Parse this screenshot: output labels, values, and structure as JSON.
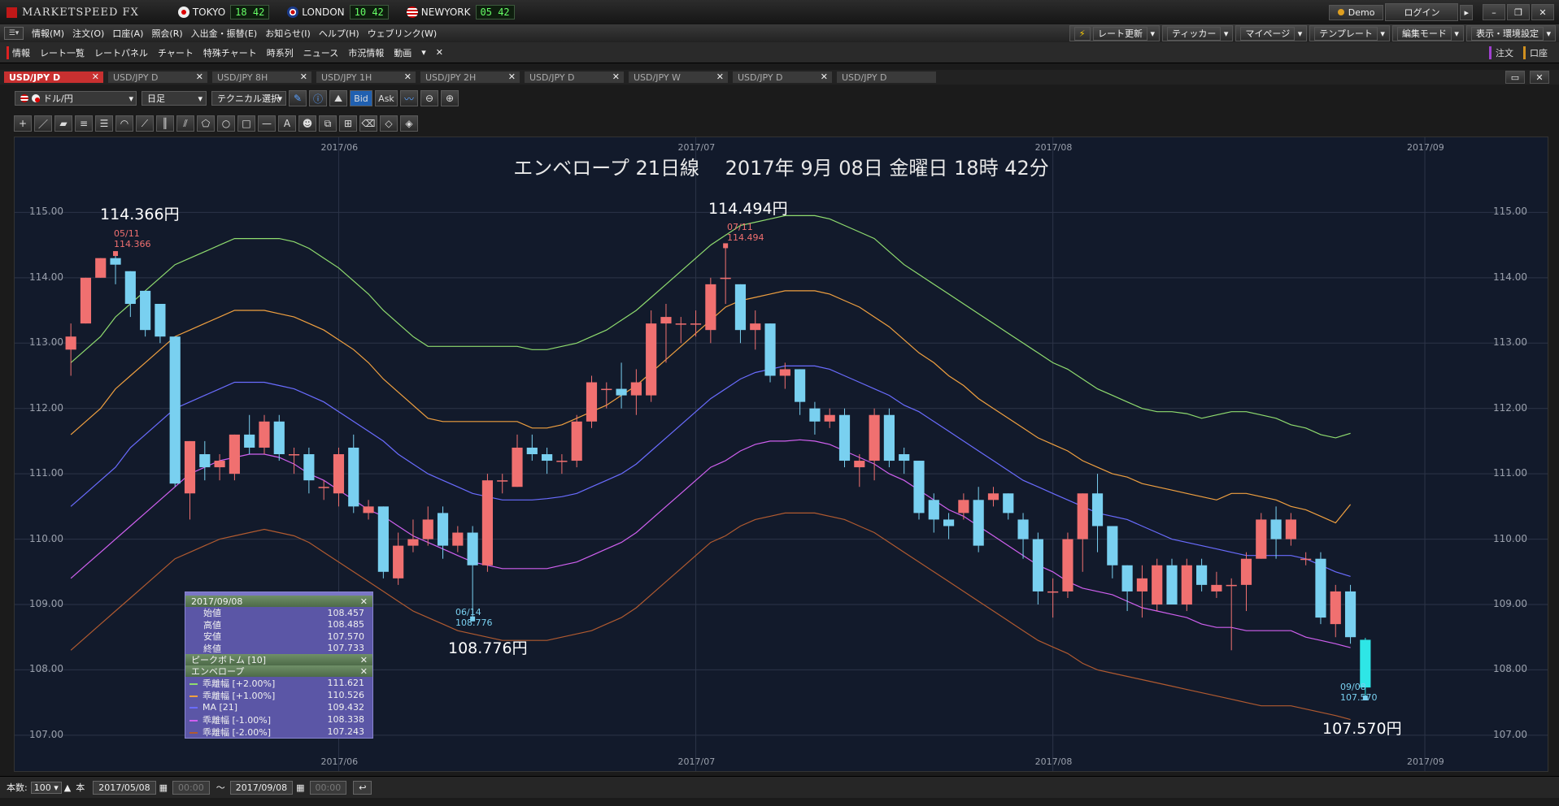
{
  "app": {
    "name": "MARKETSPEED FX"
  },
  "clocks": [
    {
      "city": "TOKYO",
      "time": "18 42"
    },
    {
      "city": "LONDON",
      "time": "10 42"
    },
    {
      "city": "NEWYORK",
      "time": "05 42"
    }
  ],
  "titlebar": {
    "demo_label": "Demo",
    "login_label": "ログイン"
  },
  "menu": [
    "情報(M)",
    "注文(O)",
    "口座(A)",
    "照会(R)",
    "入出金・振替(E)",
    "お知らせ(I)",
    "ヘルプ(H)",
    "ウェブリンク(W)"
  ],
  "right_menu": [
    "レート更新",
    "ティッカー",
    "マイページ",
    "テンプレート",
    "編集モード",
    "表示・環境設定"
  ],
  "shortcuts": [
    "情報",
    "レート一覧",
    "レートパネル",
    "チャート",
    "特殊チャート",
    "時系列",
    "ニュース",
    "市況情報",
    "動画"
  ],
  "shortcut_right": [
    "注文",
    "口座"
  ],
  "tabs": [
    {
      "label": "USD/JPY D",
      "active": true
    },
    {
      "label": "USD/JPY D",
      "active": false
    },
    {
      "label": "USD/JPY 8H",
      "active": false
    },
    {
      "label": "USD/JPY 1H",
      "active": false
    },
    {
      "label": "USD/JPY 2H",
      "active": false
    },
    {
      "label": "USD/JPY D",
      "active": false
    },
    {
      "label": "USD/JPY W",
      "active": false
    },
    {
      "label": "USD/JPY D",
      "active": false
    },
    {
      "label": "USD/JPY D",
      "active": false
    }
  ],
  "chart_options": {
    "pair": "ドル/円",
    "period": "日足",
    "technical": "テクニカル選択",
    "bid": "Bid",
    "ask": "Ask"
  },
  "chart_data": {
    "type": "candlestick",
    "title": "エンベロープ 21日線　 2017年 9月 08日 金曜日 18時 42分",
    "ylim": [
      106.7,
      115.9
    ],
    "y_ticks": [
      "115.00",
      "114.00",
      "113.00",
      "112.00",
      "111.00",
      "110.00",
      "109.00",
      "108.00",
      "107.00"
    ],
    "y_tick_values": [
      115,
      114,
      113,
      112,
      111,
      110,
      109,
      108,
      107
    ],
    "x_ticks": [
      "2017/06",
      "2017/07",
      "2017/08",
      "2017/09"
    ],
    "x_tick_index": [
      18,
      42,
      66,
      91
    ],
    "candles": [
      [
        112.9,
        113.1,
        112.5,
        113.3
      ],
      [
        113.3,
        114.0,
        113.3,
        114.0
      ],
      [
        114.0,
        114.3,
        114.0,
        114.3
      ],
      [
        114.3,
        114.2,
        113.9,
        114.37
      ],
      [
        114.1,
        113.6,
        113.4,
        114.1
      ],
      [
        113.8,
        113.2,
        113.1,
        113.8
      ],
      [
        113.6,
        113.1,
        113.0,
        113.6
      ],
      [
        113.1,
        110.85,
        110.8,
        113.1
      ],
      [
        110.7,
        111.5,
        110.3,
        111.5
      ],
      [
        111.3,
        111.1,
        110.9,
        111.5
      ],
      [
        111.1,
        111.2,
        110.9,
        111.3
      ],
      [
        111.0,
        111.6,
        110.9,
        111.6
      ],
      [
        111.6,
        111.4,
        111.3,
        111.9
      ],
      [
        111.4,
        111.8,
        111.3,
        111.9
      ],
      [
        111.8,
        111.3,
        111.2,
        111.9
      ],
      [
        111.3,
        111.3,
        111.0,
        111.4
      ],
      [
        111.3,
        110.9,
        110.7,
        111.4
      ],
      [
        110.8,
        110.8,
        110.6,
        110.9
      ],
      [
        110.7,
        111.3,
        110.5,
        111.4
      ],
      [
        111.4,
        110.5,
        110.4,
        111.6
      ],
      [
        110.4,
        110.5,
        110.3,
        110.6
      ],
      [
        110.5,
        109.5,
        109.4,
        110.5
      ],
      [
        109.4,
        109.9,
        109.3,
        110.1
      ],
      [
        109.9,
        110.0,
        109.8,
        110.3
      ],
      [
        110.0,
        110.3,
        109.9,
        110.5
      ],
      [
        110.4,
        109.9,
        109.7,
        110.5
      ],
      [
        109.9,
        110.1,
        109.8,
        110.2
      ],
      [
        110.1,
        109.6,
        108.78,
        110.2
      ],
      [
        109.6,
        110.9,
        109.5,
        111.0
      ],
      [
        110.9,
        110.9,
        110.7,
        111.0
      ],
      [
        110.8,
        111.4,
        110.8,
        111.6
      ],
      [
        111.4,
        111.3,
        111.2,
        111.6
      ],
      [
        111.3,
        111.2,
        111.0,
        111.4
      ],
      [
        111.2,
        111.2,
        111.0,
        111.3
      ],
      [
        111.2,
        111.8,
        111.1,
        111.9
      ],
      [
        111.8,
        112.4,
        111.7,
        112.5
      ],
      [
        112.3,
        112.3,
        112.0,
        112.4
      ],
      [
        112.3,
        112.2,
        112.0,
        112.7
      ],
      [
        112.2,
        112.4,
        111.9,
        112.6
      ],
      [
        112.2,
        113.3,
        112.1,
        113.5
      ],
      [
        113.3,
        113.4,
        112.7,
        113.6
      ],
      [
        113.3,
        113.3,
        113.0,
        113.4
      ],
      [
        113.3,
        113.3,
        113.1,
        113.5
      ],
      [
        113.2,
        113.9,
        113.0,
        114.0
      ],
      [
        114.0,
        114.0,
        113.6,
        114.49
      ],
      [
        113.9,
        113.2,
        113.0,
        113.9
      ],
      [
        113.2,
        113.3,
        112.9,
        113.5
      ],
      [
        113.3,
        112.5,
        112.4,
        113.3
      ],
      [
        112.5,
        112.6,
        112.3,
        112.7
      ],
      [
        112.6,
        112.1,
        111.9,
        112.6
      ],
      [
        112.0,
        111.8,
        111.6,
        112.1
      ],
      [
        111.8,
        111.9,
        111.7,
        112.0
      ],
      [
        111.9,
        111.2,
        111.1,
        112.0
      ],
      [
        111.1,
        111.2,
        110.8,
        111.3
      ],
      [
        111.2,
        111.9,
        110.9,
        112.0
      ],
      [
        111.9,
        111.2,
        111.1,
        112.0
      ],
      [
        111.3,
        111.2,
        111.0,
        111.4
      ],
      [
        111.2,
        110.4,
        110.3,
        111.2
      ],
      [
        110.6,
        110.3,
        110.1,
        110.7
      ],
      [
        110.3,
        110.2,
        110.0,
        110.4
      ],
      [
        110.4,
        110.6,
        110.3,
        110.7
      ],
      [
        110.6,
        109.9,
        109.8,
        110.8
      ],
      [
        110.6,
        110.7,
        110.5,
        110.8
      ],
      [
        110.7,
        110.4,
        110.3,
        110.7
      ],
      [
        110.3,
        110.0,
        109.7,
        110.4
      ],
      [
        110.0,
        109.2,
        109.0,
        110.1
      ],
      [
        109.2,
        109.2,
        108.8,
        109.4
      ],
      [
        109.2,
        110.0,
        109.1,
        110.1
      ],
      [
        110.0,
        110.7,
        109.5,
        110.7
      ],
      [
        110.7,
        110.2,
        109.8,
        111.0
      ],
      [
        110.2,
        109.6,
        109.4,
        110.2
      ],
      [
        109.6,
        109.2,
        108.9,
        109.6
      ],
      [
        109.2,
        109.4,
        108.8,
        109.6
      ],
      [
        109.0,
        109.6,
        108.9,
        109.7
      ],
      [
        109.6,
        109.0,
        109.0,
        109.7
      ],
      [
        109.0,
        109.6,
        108.9,
        109.7
      ],
      [
        109.6,
        109.3,
        109.2,
        109.7
      ],
      [
        109.2,
        109.3,
        109.1,
        109.5
      ],
      [
        109.3,
        109.3,
        108.3,
        109.4
      ],
      [
        109.3,
        109.7,
        108.9,
        109.8
      ],
      [
        109.7,
        110.3,
        109.7,
        110.4
      ],
      [
        110.3,
        110.0,
        109.7,
        110.5
      ],
      [
        110.0,
        110.3,
        109.9,
        110.4
      ],
      [
        109.7,
        109.7,
        109.6,
        109.8
      ],
      [
        109.7,
        108.8,
        108.7,
        109.8
      ],
      [
        108.7,
        109.2,
        108.5,
        109.3
      ],
      [
        109.2,
        108.5,
        108.4,
        109.3
      ],
      [
        108.46,
        107.73,
        107.57,
        108.49
      ]
    ],
    "ma21": [
      110.5,
      110.7,
      110.9,
      111.1,
      111.4,
      111.6,
      111.8,
      112.0,
      112.1,
      112.2,
      112.3,
      112.4,
      112.4,
      112.4,
      112.35,
      112.3,
      112.2,
      112.1,
      111.95,
      111.8,
      111.65,
      111.5,
      111.3,
      111.15,
      111.0,
      110.9,
      110.8,
      110.7,
      110.65,
      110.6,
      110.6,
      110.6,
      110.62,
      110.65,
      110.7,
      110.8,
      110.9,
      111.0,
      111.15,
      111.35,
      111.55,
      111.75,
      111.95,
      112.15,
      112.3,
      112.45,
      112.55,
      112.6,
      112.65,
      112.65,
      112.65,
      112.6,
      112.5,
      112.4,
      112.3,
      112.2,
      112.05,
      111.95,
      111.8,
      111.65,
      111.5,
      111.35,
      111.2,
      111.05,
      110.9,
      110.8,
      110.7,
      110.6,
      110.5,
      110.4,
      110.35,
      110.3,
      110.2,
      110.1,
      110.0,
      109.95,
      109.9,
      109.85,
      109.8,
      109.75,
      109.75,
      109.75,
      109.75,
      109.7,
      109.6,
      109.5,
      109.43
    ],
    "upper2": [
      112.7,
      112.9,
      113.1,
      113.4,
      113.6,
      113.8,
      114.0,
      114.2,
      114.3,
      114.4,
      114.5,
      114.6,
      114.6,
      114.6,
      114.6,
      114.55,
      114.45,
      114.3,
      114.15,
      113.95,
      113.75,
      113.5,
      113.3,
      113.1,
      112.95,
      112.95,
      112.95,
      112.95,
      112.95,
      112.95,
      112.95,
      112.9,
      112.9,
      112.95,
      113.0,
      113.1,
      113.2,
      113.35,
      113.5,
      113.7,
      113.9,
      114.1,
      114.3,
      114.5,
      114.65,
      114.8,
      114.85,
      114.9,
      114.95,
      114.95,
      114.95,
      114.9,
      114.8,
      114.7,
      114.6,
      114.4,
      114.2,
      114.05,
      113.9,
      113.75,
      113.6,
      113.45,
      113.3,
      113.15,
      113.0,
      112.85,
      112.7,
      112.6,
      112.45,
      112.3,
      112.2,
      112.1,
      112.0,
      111.95,
      111.95,
      111.92,
      111.85,
      111.9,
      111.95,
      111.95,
      111.9,
      111.85,
      111.75,
      111.7,
      111.6,
      111.55,
      111.62
    ],
    "upper1": [
      111.6,
      111.8,
      112.0,
      112.3,
      112.5,
      112.7,
      112.9,
      113.1,
      113.2,
      113.3,
      113.4,
      113.5,
      113.5,
      113.5,
      113.45,
      113.4,
      113.3,
      113.2,
      113.05,
      112.9,
      112.7,
      112.45,
      112.25,
      112.05,
      111.85,
      111.8,
      111.8,
      111.8,
      111.8,
      111.8,
      111.8,
      111.7,
      111.7,
      111.75,
      111.85,
      111.95,
      112.05,
      112.2,
      112.35,
      112.55,
      112.75,
      112.95,
      113.15,
      113.35,
      113.55,
      113.65,
      113.7,
      113.75,
      113.8,
      113.8,
      113.8,
      113.75,
      113.65,
      113.55,
      113.4,
      113.25,
      113.05,
      112.85,
      112.7,
      112.5,
      112.35,
      112.15,
      112.0,
      111.85,
      111.7,
      111.55,
      111.45,
      111.35,
      111.2,
      111.1,
      111.0,
      110.95,
      110.85,
      110.8,
      110.75,
      110.7,
      110.65,
      110.6,
      110.7,
      110.7,
      110.65,
      110.6,
      110.5,
      110.45,
      110.35,
      110.25,
      110.53
    ],
    "lower1": [
      109.4,
      109.6,
      109.8,
      110.0,
      110.2,
      110.4,
      110.6,
      110.8,
      111.0,
      111.1,
      111.2,
      111.25,
      111.3,
      111.3,
      111.25,
      111.15,
      111.0,
      110.9,
      110.75,
      110.6,
      110.45,
      110.35,
      110.2,
      110.05,
      109.95,
      109.85,
      109.75,
      109.65,
      109.6,
      109.55,
      109.55,
      109.55,
      109.55,
      109.6,
      109.65,
      109.75,
      109.85,
      109.95,
      110.1,
      110.3,
      110.5,
      110.7,
      110.9,
      111.1,
      111.2,
      111.35,
      111.45,
      111.5,
      111.5,
      111.52,
      111.5,
      111.45,
      111.35,
      111.25,
      111.15,
      111.0,
      110.9,
      110.75,
      110.6,
      110.45,
      110.35,
      110.2,
      110.05,
      109.9,
      109.75,
      109.6,
      109.5,
      109.35,
      109.25,
      109.2,
      109.15,
      109.05,
      108.95,
      108.9,
      108.85,
      108.8,
      108.7,
      108.65,
      108.65,
      108.6,
      108.6,
      108.6,
      108.6,
      108.5,
      108.45,
      108.4,
      108.34
    ],
    "lower2": [
      108.3,
      108.5,
      108.7,
      108.9,
      109.1,
      109.3,
      109.5,
      109.7,
      109.8,
      109.9,
      110.0,
      110.05,
      110.1,
      110.15,
      110.1,
      110.05,
      109.95,
      109.8,
      109.65,
      109.5,
      109.35,
      109.2,
      109.05,
      108.9,
      108.8,
      108.7,
      108.6,
      108.55,
      108.5,
      108.45,
      108.45,
      108.45,
      108.45,
      108.5,
      108.55,
      108.6,
      108.7,
      108.8,
      108.95,
      109.15,
      109.35,
      109.55,
      109.75,
      109.95,
      110.05,
      110.2,
      110.3,
      110.35,
      110.4,
      110.4,
      110.4,
      110.35,
      110.3,
      110.2,
      110.1,
      109.95,
      109.8,
      109.65,
      109.5,
      109.35,
      109.2,
      109.05,
      108.9,
      108.75,
      108.6,
      108.45,
      108.35,
      108.25,
      108.1,
      108.0,
      107.95,
      107.9,
      107.85,
      107.8,
      107.75,
      107.7,
      107.65,
      107.6,
      107.55,
      107.5,
      107.45,
      107.45,
      107.45,
      107.4,
      107.35,
      107.3,
      107.24
    ],
    "annotations": {
      "high1": {
        "big": "114.366円",
        "date": "05/11",
        "value": "114.366"
      },
      "high2": {
        "big": "114.494円",
        "date": "07/11",
        "value": "114.494"
      },
      "low1": {
        "big": "108.776円",
        "date": "06/14",
        "value": "108.776"
      },
      "last": {
        "big": "107.570円",
        "date": "09/08",
        "value": "107.570"
      }
    },
    "colors": {
      "up": "#f07070",
      "down": "#79d0f0",
      "last": "#2ee6e6",
      "ma": "#6a6cff",
      "upper2": "#8fdc6f",
      "upper1": "#f0a040",
      "lower1": "#d060f0",
      "lower2": "#b05a30"
    }
  },
  "data_window": {
    "date": "2017/09/08",
    "rows": [
      {
        "label": "始値",
        "value": "108.457"
      },
      {
        "label": "高値",
        "value": "108.485"
      },
      {
        "label": "安値",
        "value": "107.570"
      },
      {
        "label": "終値",
        "value": "107.733"
      }
    ],
    "peak_label": "ピークボトム [10]",
    "env_label": "エンベロープ",
    "indicators": [
      {
        "label": "乖離幅 [+2.00%]",
        "value": "111.621",
        "color": "#8fdc6f"
      },
      {
        "label": "乖離幅 [+1.00%]",
        "value": "110.526",
        "color": "#f0a040"
      },
      {
        "label": "MA [21]",
        "value": "109.432",
        "color": "#6a6cff"
      },
      {
        "label": "乖離幅 [-1.00%]",
        "value": "108.338",
        "color": "#d060f0"
      },
      {
        "label": "乖離幅 [-2.00%]",
        "value": "107.243",
        "color": "#b05a30"
      }
    ]
  },
  "statusbar": {
    "count_label": "本数:",
    "count": "100",
    "unit": "本",
    "start_date": "2017/05/08",
    "start_time": "00:00",
    "sep": "〜",
    "end_date": "2017/09/08",
    "end_time": "00:00"
  }
}
